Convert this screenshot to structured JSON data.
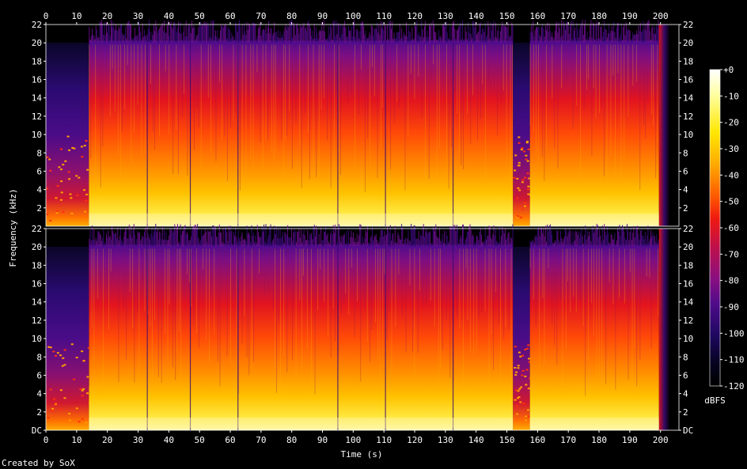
{
  "chart_data": {
    "type": "heatmap",
    "subtype": "spectrogram",
    "xlabel": "Time (s)",
    "ylabel": "Frequency (kHz)",
    "x_ticks": [
      0,
      10,
      20,
      30,
      40,
      50,
      60,
      70,
      80,
      90,
      100,
      110,
      120,
      130,
      140,
      150,
      160,
      170,
      180,
      190,
      200
    ],
    "xlim": [
      0,
      206
    ],
    "channels": [
      {
        "y_ticks": [
          "22",
          "20",
          "18",
          "16",
          "14",
          "12",
          "10",
          "8",
          "6",
          "4",
          "2"
        ]
      },
      {
        "y_ticks": [
          "22",
          "20",
          "18",
          "16",
          "14",
          "12",
          "10",
          "8",
          "6",
          "4",
          "2",
          "DC"
        ]
      }
    ],
    "ylim_khz": [
      0,
      22
    ],
    "colorbar": {
      "label": "dBFS",
      "ticks": [
        "+0",
        "-10",
        "-20",
        "-30",
        "-40",
        "-50",
        "-60",
        "-70",
        "-80",
        "-90",
        "-100",
        "-110",
        "-120"
      ],
      "range": [
        -120,
        0
      ]
    },
    "segments": [
      {
        "start": 0,
        "end": 14,
        "level": "quiet"
      },
      {
        "start": 14,
        "end": 152,
        "level": "loud"
      },
      {
        "start": 152,
        "end": 157.5,
        "level": "quiet"
      },
      {
        "start": 157.5,
        "end": 199.5,
        "level": "loud"
      },
      {
        "start": 199.5,
        "end": 203,
        "level": "fade"
      }
    ],
    "transients_s": [
      33,
      47,
      62.5,
      95,
      110.5,
      132.5
    ],
    "colors": {
      "background": "#000000",
      "gradient": [
        "#ffffff",
        "#ffffa0",
        "#ffe600",
        "#ffaa00",
        "#ff5a00",
        "#ee1a10",
        "#c0104a",
        "#8a0f80",
        "#4f0c8a",
        "#1e0860",
        "#05031e",
        "#000000"
      ]
    }
  },
  "footer": {
    "credit": "Created by SoX"
  }
}
